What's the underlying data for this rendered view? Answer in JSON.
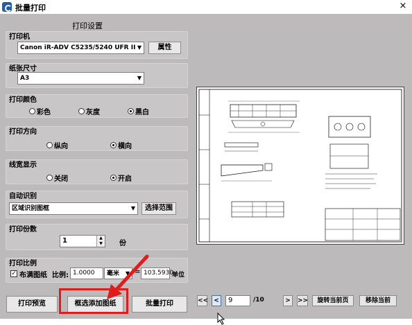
{
  "window": {
    "title": "批量打印",
    "close": "×"
  },
  "settings_title": "打印设置",
  "printer": {
    "label": "打印机",
    "selected": "Canon iR-ADV C5235/5240 UFR II",
    "properties_button": "属性"
  },
  "paper": {
    "label": "纸张尺寸",
    "selected": "A3"
  },
  "color": {
    "label": "打印颜色",
    "options": [
      "彩色",
      "灰度",
      "黑白"
    ],
    "selected_index": 2
  },
  "orientation": {
    "label": "打印方向",
    "options": [
      "纵向",
      "横向"
    ],
    "selected_index": 1
  },
  "line_width": {
    "label": "线宽显示",
    "options": [
      "关闭",
      "开启"
    ],
    "selected_index": 1
  },
  "auto_detect": {
    "label": "自动识别",
    "selected": "区域识别图框",
    "range_button": "选择范围"
  },
  "copies": {
    "label": "打印份数",
    "value": "1",
    "unit": "份"
  },
  "scale": {
    "label": "打印比例",
    "fit_label": "布满图纸",
    "fit_checked": true,
    "ratio_label": "比例:",
    "ratio_value": "1.0000",
    "unit_selected": "毫米",
    "equals": "=",
    "unit_value": "103.5930",
    "unit_label": "单位"
  },
  "buttons": {
    "preview": "打印预览",
    "add_drawing": "框选添加图纸",
    "batch_print": "批量打印"
  },
  "pager": {
    "first": "<<",
    "prev": "<",
    "current_page": "9",
    "total": "/10",
    "next": ">",
    "last": ">>",
    "rotate": "旋转当前页",
    "remove": "移除当前"
  },
  "colors": {
    "highlight": "#e31b1b",
    "background": "#bcbabb"
  },
  "icons": [
    "app-logo-icon",
    "close-icon",
    "dropdown-chevron-icon",
    "spin-arrows-icon",
    "mouse-cursor-icon",
    "red-annotation-arrow"
  ]
}
